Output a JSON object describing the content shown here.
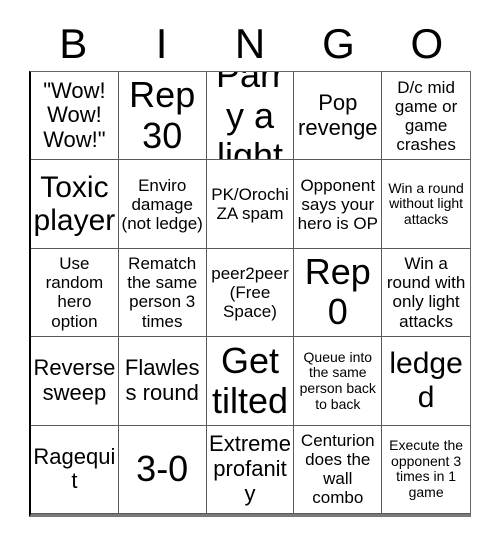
{
  "card": {
    "title_letters": [
      "B",
      "I",
      "N",
      "G",
      "O"
    ],
    "cells": [
      {
        "text": "\"Wow! Wow! Wow!\"",
        "size": "sz-md"
      },
      {
        "text": "Rep 30",
        "size": "sz-xl"
      },
      {
        "text": "Parry a light",
        "size": "sz-xl"
      },
      {
        "text": "Pop revenge",
        "size": "sz-md"
      },
      {
        "text": "D/c mid game or game crashes",
        "size": "sz-sm"
      },
      {
        "text": "Toxic player",
        "size": "sz-lg"
      },
      {
        "text": "Enviro damage (not ledge)",
        "size": "sz-sm"
      },
      {
        "text": "PK/Orochi ZA spam",
        "size": "sz-sm"
      },
      {
        "text": "Opponent says your hero is OP",
        "size": "sz-sm"
      },
      {
        "text": "Win a round without light attacks",
        "size": "sz-xs"
      },
      {
        "text": "Use random hero option",
        "size": "sz-sm"
      },
      {
        "text": "Rematch the same person 3 times",
        "size": "sz-sm"
      },
      {
        "text": "peer2peer (Free Space)",
        "size": "sz-sm"
      },
      {
        "text": "Rep 0",
        "size": "sz-xl"
      },
      {
        "text": "Win a round with only light attacks",
        "size": "sz-sm"
      },
      {
        "text": "Reverse sweep",
        "size": "sz-md"
      },
      {
        "text": "Flawless round",
        "size": "sz-md"
      },
      {
        "text": "Get tilted",
        "size": "sz-xl"
      },
      {
        "text": "Queue into the same person back to back",
        "size": "sz-xs"
      },
      {
        "text": "ledged",
        "size": "sz-lg"
      },
      {
        "text": "Ragequit",
        "size": "sz-md"
      },
      {
        "text": "3-0",
        "size": "sz-xl"
      },
      {
        "text": "Extreme profanity",
        "size": "sz-md"
      },
      {
        "text": "Centurion does the wall combo",
        "size": "sz-sm"
      },
      {
        "text": "Execute the opponent 3 times in 1 game",
        "size": "sz-xs"
      }
    ]
  }
}
